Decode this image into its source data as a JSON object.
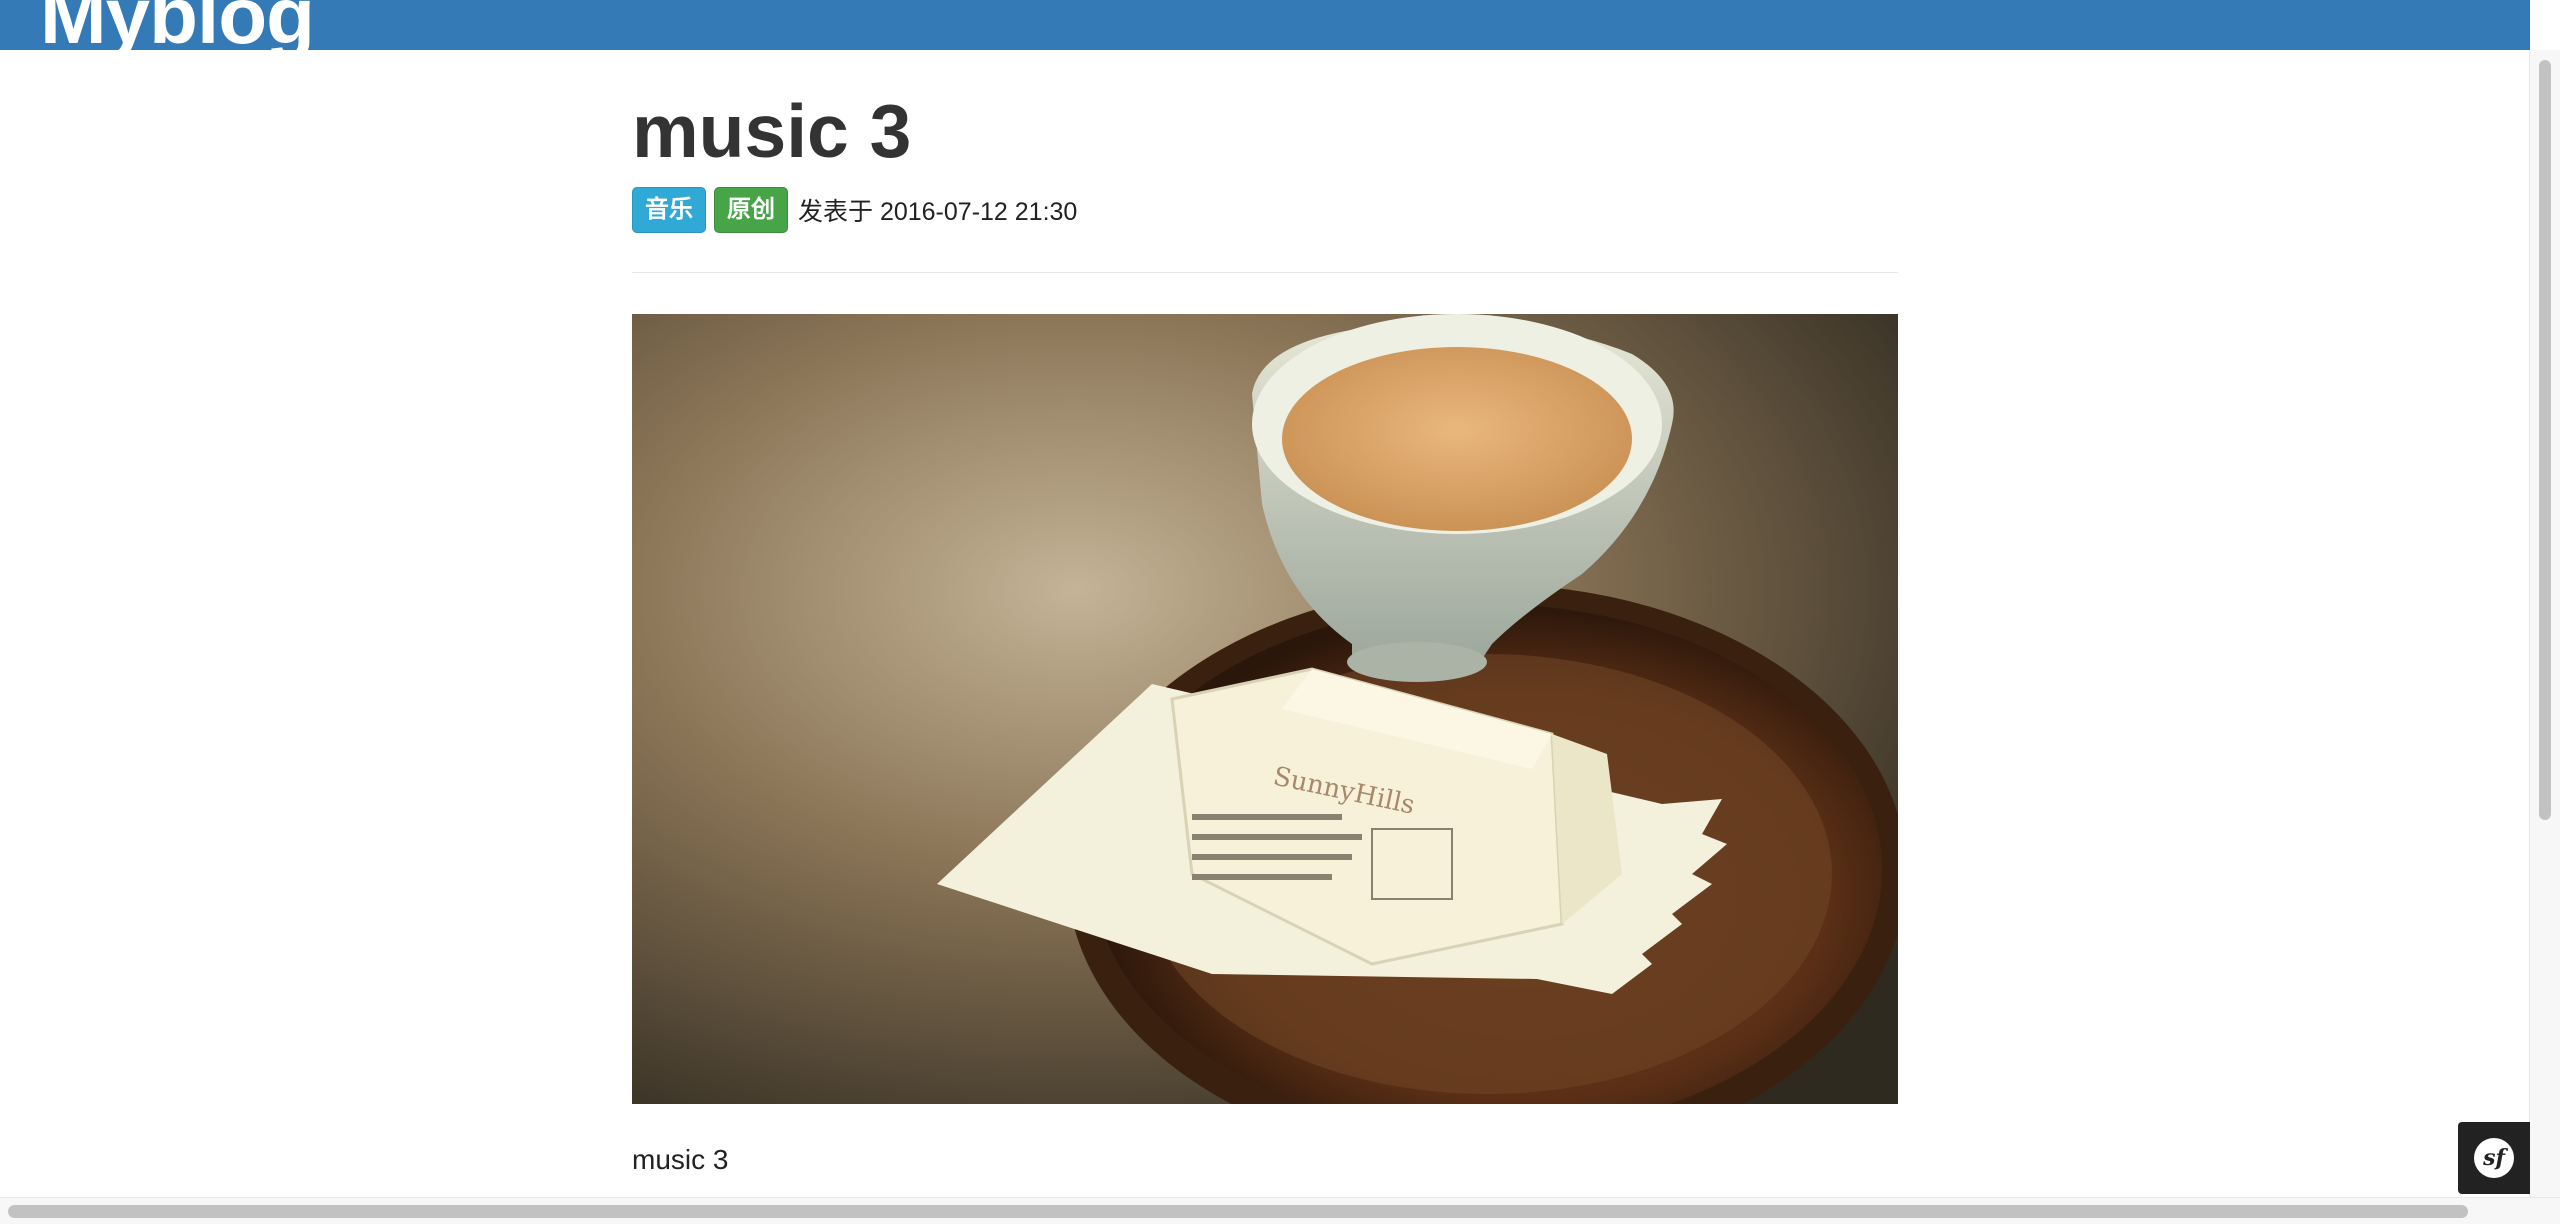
{
  "header": {
    "brand": "Myblog"
  },
  "post": {
    "title": "music 3",
    "tags": [
      {
        "label": "音乐",
        "color": "#31a9d6"
      },
      {
        "label": "原创",
        "color": "#47a447"
      }
    ],
    "published": "发表于 2016-07-12 21:30",
    "image_icon": "photo-tea-cup-on-wooden-tray",
    "body": "music 3"
  },
  "colors": {
    "navbar": "#337ab7",
    "tag_info": "#31a9d6",
    "tag_success": "#47a447"
  },
  "toolbar": {
    "icon": "symfony-logo-icon",
    "glyph": "sf"
  }
}
